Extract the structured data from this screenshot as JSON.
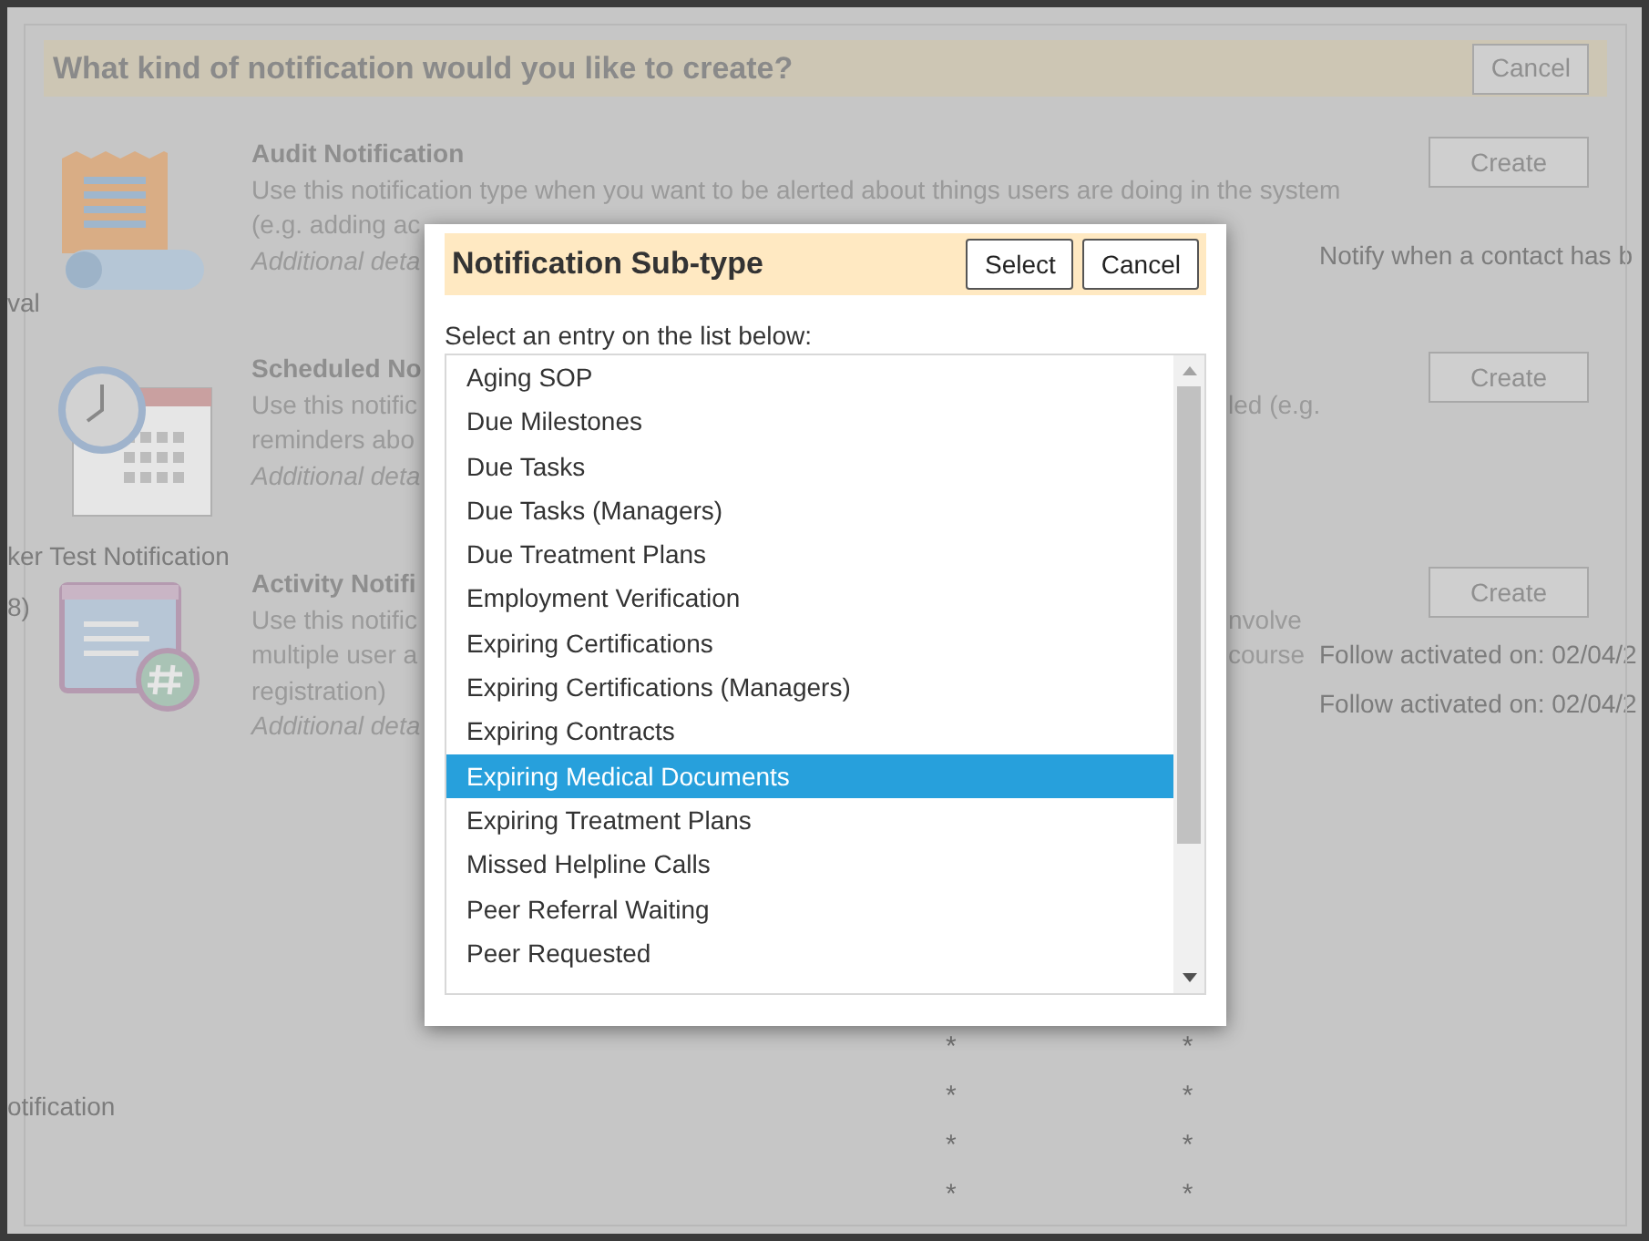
{
  "background_page": {
    "left_fragments": [
      "val",
      "ker Test Notification",
      "8)",
      "otification"
    ],
    "right_fragments": [
      "Notify when a contact has b",
      "Follow activated on: 02/04/2",
      "Follow activated on: 02/04/2"
    ],
    "mark_rows": [
      [
        "*",
        "*"
      ],
      [
        "*",
        "*"
      ],
      [
        "*",
        "*"
      ],
      [
        "*",
        "*"
      ]
    ]
  },
  "create_dialog": {
    "title": "What kind of notification would you like to create?",
    "cancel": "Cancel",
    "items": [
      {
        "kind": "audit",
        "title": "Audit Notification",
        "full_line": "Use this notification type when you want to be alerted about things users are doing in the system",
        "lines": [
          {
            "left": "(e.g. adding ac"
          }
        ],
        "details": "Additional deta",
        "button": "Create"
      },
      {
        "kind": "scheduled",
        "title": "Scheduled No",
        "lines": [
          {
            "left": "Use this notific",
            "right": "led (e.g."
          },
          {
            "left": "reminders abo"
          }
        ],
        "details": "Additional deta",
        "button": "Create"
      },
      {
        "kind": "activity",
        "title": "Activity Notifi",
        "lines": [
          {
            "left": "Use this notific",
            "right": "nvolve"
          },
          {
            "left": "multiple user a",
            "right": "course"
          },
          {
            "left": "registration)"
          }
        ],
        "details": "Additional deta",
        "button": "Create"
      }
    ]
  },
  "subtype_dialog": {
    "title": "Notification Sub-type",
    "select": "Select",
    "cancel": "Cancel",
    "prompt": "Select an entry on the list below:",
    "entries": [
      {
        "label": "Aging SOP",
        "selected": false
      },
      {
        "label": "Due Milestones",
        "selected": false
      },
      {
        "label": "Due Tasks",
        "selected": false
      },
      {
        "label": "Due Tasks (Managers)",
        "selected": false
      },
      {
        "label": "Due Treatment Plans",
        "selected": false
      },
      {
        "label": "Employment Verification",
        "selected": false
      },
      {
        "label": "Expiring Certifications",
        "selected": false
      },
      {
        "label": "Expiring Certifications (Managers)",
        "selected": false
      },
      {
        "label": "Expiring Contracts",
        "selected": false
      },
      {
        "label": "Expiring Medical Documents",
        "selected": true
      },
      {
        "label": "Expiring Treatment Plans",
        "selected": false
      },
      {
        "label": "Missed Helpline Calls",
        "selected": false
      },
      {
        "label": "Peer Referral Waiting",
        "selected": false
      },
      {
        "label": "Peer Requested",
        "selected": false
      }
    ]
  }
}
